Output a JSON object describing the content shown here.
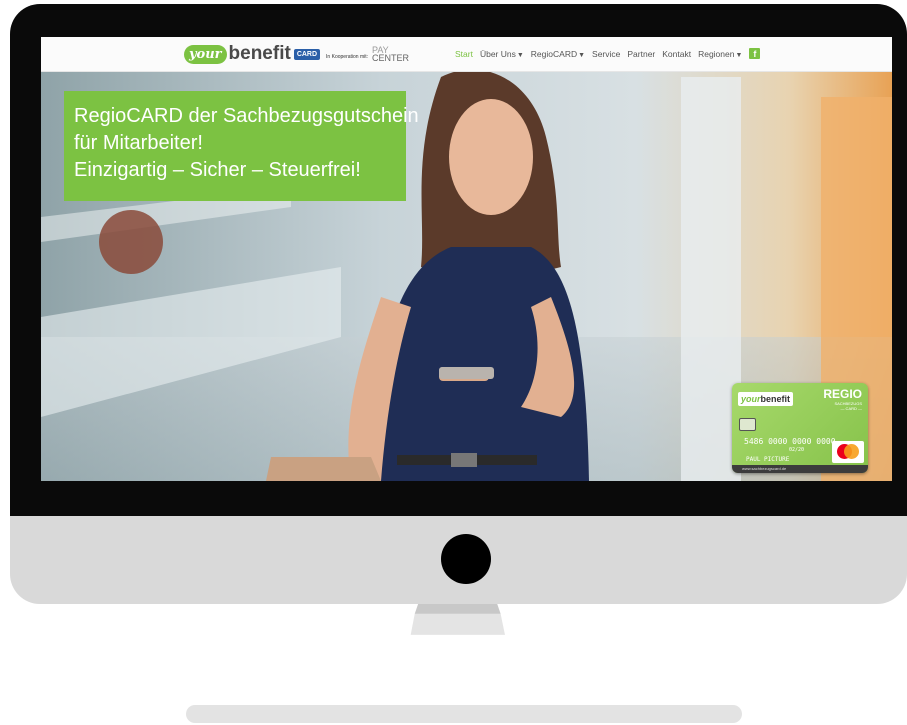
{
  "brand": {
    "your": "your",
    "benefit": "benefit",
    "card_badge": "CARD",
    "cooperation": "In Kooperation mit:",
    "pay": "PAY",
    "center": "CENTER"
  },
  "nav": {
    "items": [
      {
        "label": "Start",
        "active": true,
        "dropdown": false
      },
      {
        "label": "Über Uns",
        "active": false,
        "dropdown": true
      },
      {
        "label": "RegioCARD",
        "active": false,
        "dropdown": true
      },
      {
        "label": "Service",
        "active": false,
        "dropdown": false
      },
      {
        "label": "Partner",
        "active": false,
        "dropdown": false
      },
      {
        "label": "Kontakt",
        "active": false,
        "dropdown": false
      },
      {
        "label": "Regionen",
        "active": false,
        "dropdown": true
      }
    ],
    "social_icon": "facebook-icon",
    "social_glyph": "f"
  },
  "hero": {
    "line1": "RegioCARD der Sachbezugsgutschein",
    "line2": "für Mitarbeiter!",
    "line3": "Einzigartig – Sicher – Steuerfrei!"
  },
  "card": {
    "brand_your": "your",
    "brand_benefit": "benefit",
    "regio": "REGIO",
    "subtitle1": "SACHBEZUGS",
    "subtitle2": "— CARD —",
    "number": "5486 0000 0000 0000",
    "expiry": "02/20",
    "holder": "PAUL PICTURE",
    "website": "www.sachbezugscard.de"
  },
  "colors": {
    "accent": "#7cc242",
    "nav_text": "#555555",
    "frame": "#0a0a0a",
    "chin": "#d9d9d9"
  }
}
